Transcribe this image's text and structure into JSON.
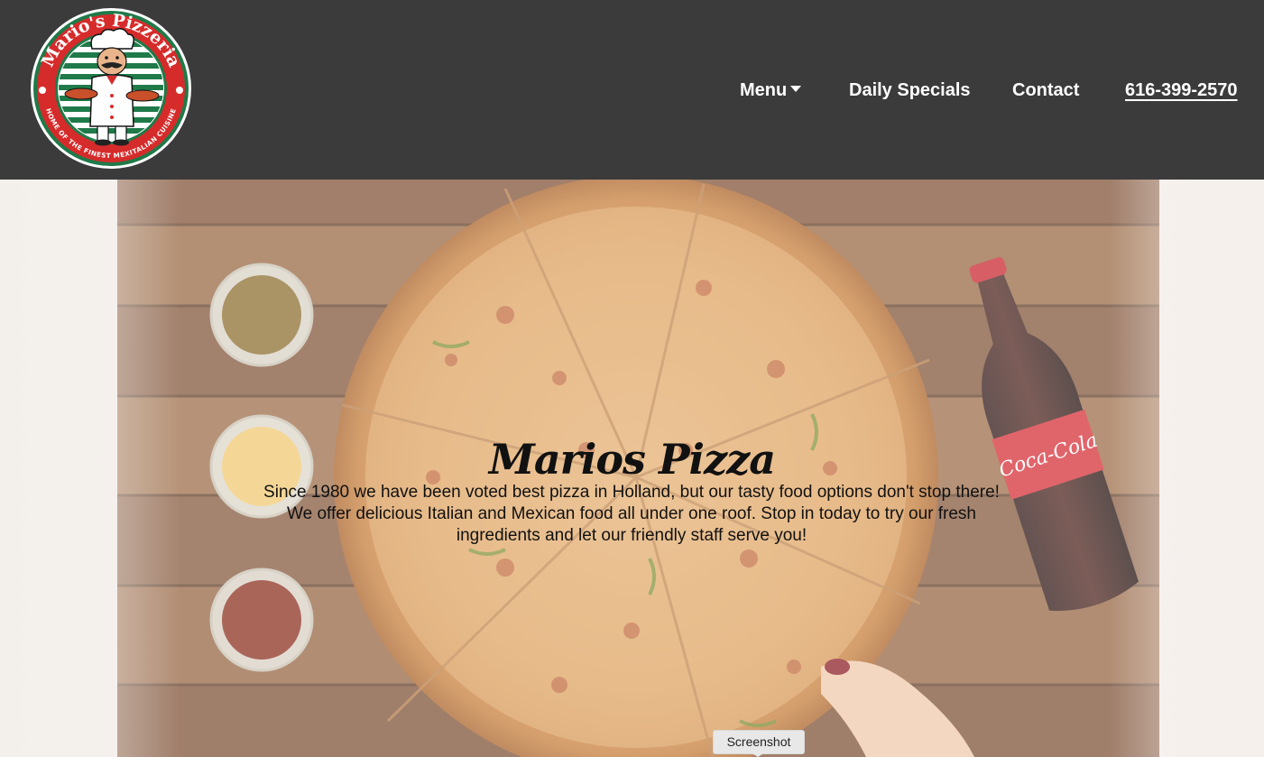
{
  "header": {
    "logo": {
      "top_text": "Mario's Pizzeria",
      "bottom_text": "HOME OF THE FINEST MEXITALIAN CUISINE"
    },
    "nav": {
      "menu_label": "Menu",
      "specials_label": "Daily Specials",
      "contact_label": "Contact",
      "phone_label": "616-399-2570"
    }
  },
  "hero": {
    "title": "Marios Pizza",
    "text": "Since 1980 we have been voted best pizza in Holland, but our tasty food options don't stop there! We offer delicious Italian and Mexican food all under one roof. Stop in today to try our fresh ingredients and let our friendly staff serve you!",
    "bottle_label": "Coca-Cola"
  },
  "tooltip": {
    "label": "Screenshot"
  },
  "colors": {
    "header_bg": "#3b3b3b",
    "nav_text": "#ffffff",
    "logo_red": "#d42a2a",
    "logo_green": "#1e7a4a"
  }
}
